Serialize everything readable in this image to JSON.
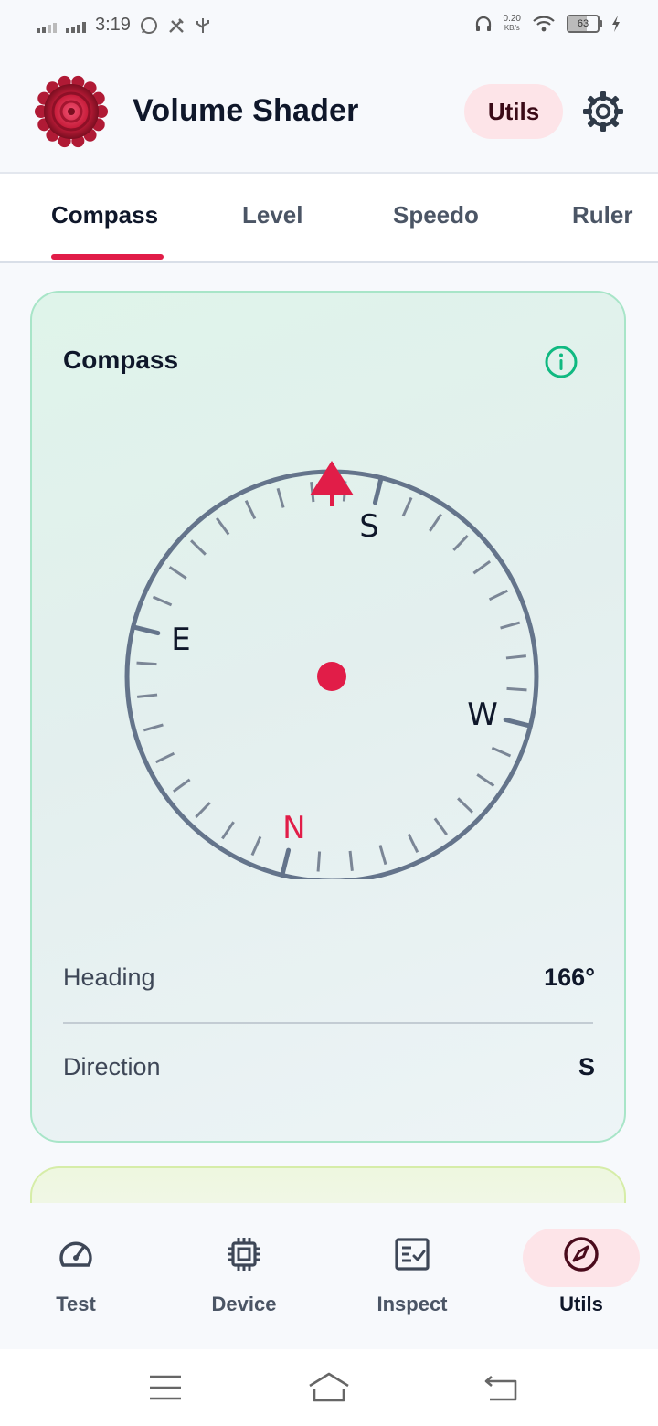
{
  "status_bar": {
    "time": "3:19",
    "net_speed_value": "0.20",
    "net_speed_unit": "KB/s",
    "battery_level": "63"
  },
  "header": {
    "app_title": "Volume Shader",
    "utils_chip": "Utils"
  },
  "tabs": [
    {
      "label": "Compass",
      "active": true
    },
    {
      "label": "Level",
      "active": false
    },
    {
      "label": "Speedo",
      "active": false
    },
    {
      "label": "Ruler",
      "active": false
    }
  ],
  "compass_card": {
    "title": "Compass",
    "dial_labels": {
      "north": "N",
      "south": "S",
      "east": "E",
      "west": "W"
    },
    "heading_label": "Heading",
    "heading_value": "166°",
    "heading_degrees": 166,
    "direction_label": "Direction",
    "direction_value": "S"
  },
  "bottom_nav": [
    {
      "label": "Test",
      "icon": "speedometer-icon",
      "active": false
    },
    {
      "label": "Device",
      "icon": "chip-icon",
      "active": false
    },
    {
      "label": "Inspect",
      "icon": "checklist-icon",
      "active": false
    },
    {
      "label": "Utils",
      "icon": "compass-icon",
      "active": true
    }
  ],
  "colors": {
    "accent": "#e11d48",
    "accent_soft": "#fde4e8",
    "card_border": "#a8e5c8",
    "dial": "#64748b",
    "info_icon": "#10b981"
  }
}
